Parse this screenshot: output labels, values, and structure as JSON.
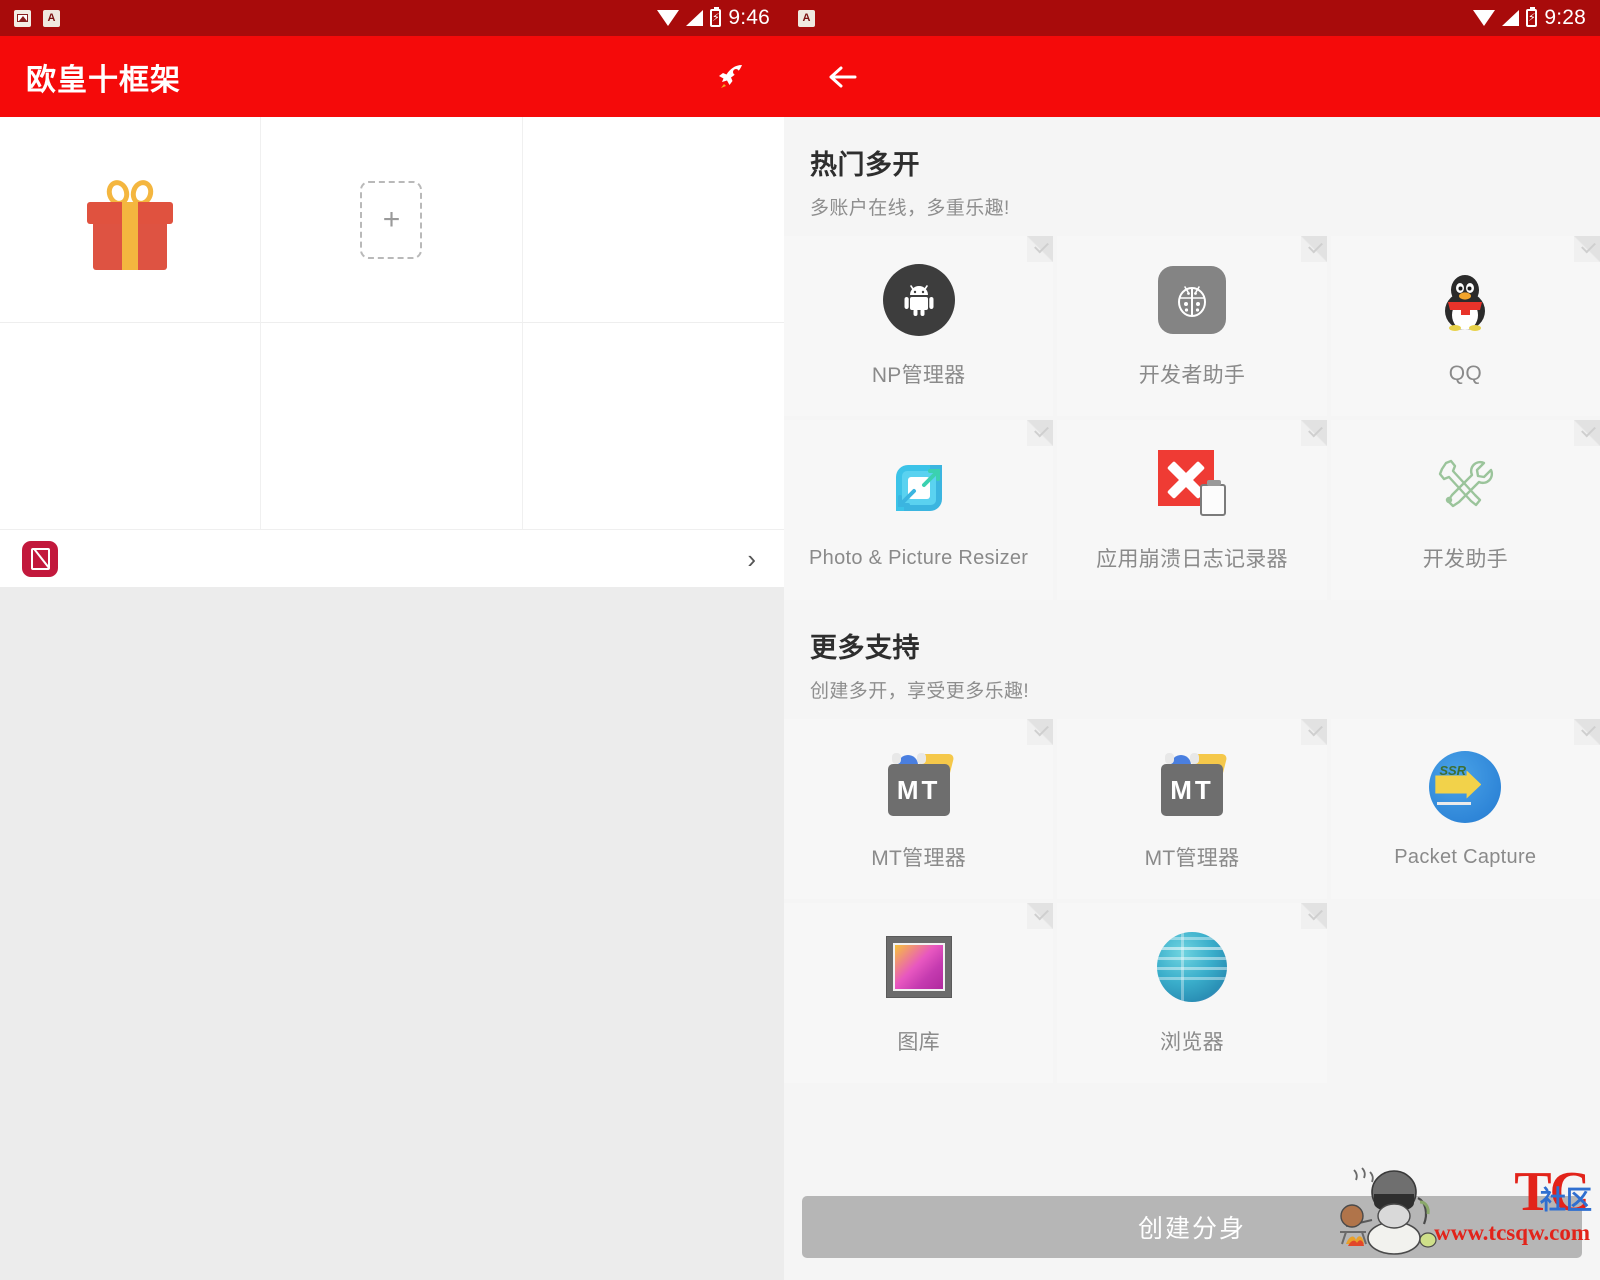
{
  "left_panel": {
    "statusbar": {
      "time": "9:46",
      "notification_icons": [
        "image-icon",
        "letter-a-icon"
      ],
      "system_icons": [
        "wifi-icon",
        "signal-icon",
        "battery-charging-icon"
      ]
    },
    "appbar": {
      "title": "欧皇十框架",
      "action_icon": "rocket-icon",
      "background_color": "#f50a0a"
    },
    "grid": {
      "cells": [
        {
          "type": "gift",
          "icon": "gift-box-icon",
          "label": ""
        },
        {
          "type": "add",
          "icon": "plus-icon",
          "label": "+"
        },
        {
          "type": "empty",
          "icon": "",
          "label": ""
        },
        {
          "type": "empty",
          "icon": "",
          "label": ""
        },
        {
          "type": "empty",
          "icon": "",
          "label": ""
        },
        {
          "type": "empty",
          "icon": "",
          "label": ""
        }
      ]
    },
    "list_row": {
      "icon": "no-image-red-icon",
      "label": "",
      "chevron": "›"
    }
  },
  "right_panel": {
    "statusbar": {
      "time": "9:28",
      "notification_icons": [
        "letter-a-icon"
      ],
      "system_icons": [
        "wifi-icon",
        "signal-icon",
        "battery-charging-icon"
      ]
    },
    "appbar": {
      "back_icon": "arrow-left-icon",
      "background_color": "#f50a0a"
    },
    "sections": [
      {
        "title": "热门多开",
        "subtitle": "多账户在线，多重乐趣!",
        "apps": [
          {
            "label": "NP管理器",
            "icon": "android-circle-icon",
            "selected_marker": true
          },
          {
            "label": "开发者助手",
            "icon": "ladybug-icon",
            "selected_marker": true
          },
          {
            "label": "QQ",
            "icon": "qq-penguin-icon",
            "selected_marker": true
          },
          {
            "label": "Photo & Picture Resizer",
            "icon": "resize-arrows-icon",
            "selected_marker": true
          },
          {
            "label": "应用崩溃日志记录器",
            "icon": "red-x-clipboard-icon",
            "selected_marker": true
          },
          {
            "label": "开发助手",
            "icon": "wrench-screwdriver-icon",
            "selected_marker": true
          }
        ]
      },
      {
        "title": "更多支持",
        "subtitle": "创建多开，享受更多乐趣!",
        "apps": [
          {
            "label": "MT管理器",
            "icon": "mt-folder-icon",
            "selected_marker": true
          },
          {
            "label": "MT管理器",
            "icon": "mt-folder-icon",
            "selected_marker": true
          },
          {
            "label": "Packet Capture",
            "icon": "packet-capture-icon",
            "selected_marker": true
          },
          {
            "label": "图库",
            "icon": "gallery-frame-icon",
            "selected_marker": true
          },
          {
            "label": "浏览器",
            "icon": "globe-icon",
            "selected_marker": true
          }
        ]
      }
    ],
    "create_button": {
      "label": "创建分身",
      "enabled": false,
      "color": "#b6b6b6"
    }
  },
  "watermark": {
    "brand": "TC",
    "brand_suffix": "社区",
    "url": "www.tcsqw.com",
    "character_icon": "campfire-character-icon"
  }
}
